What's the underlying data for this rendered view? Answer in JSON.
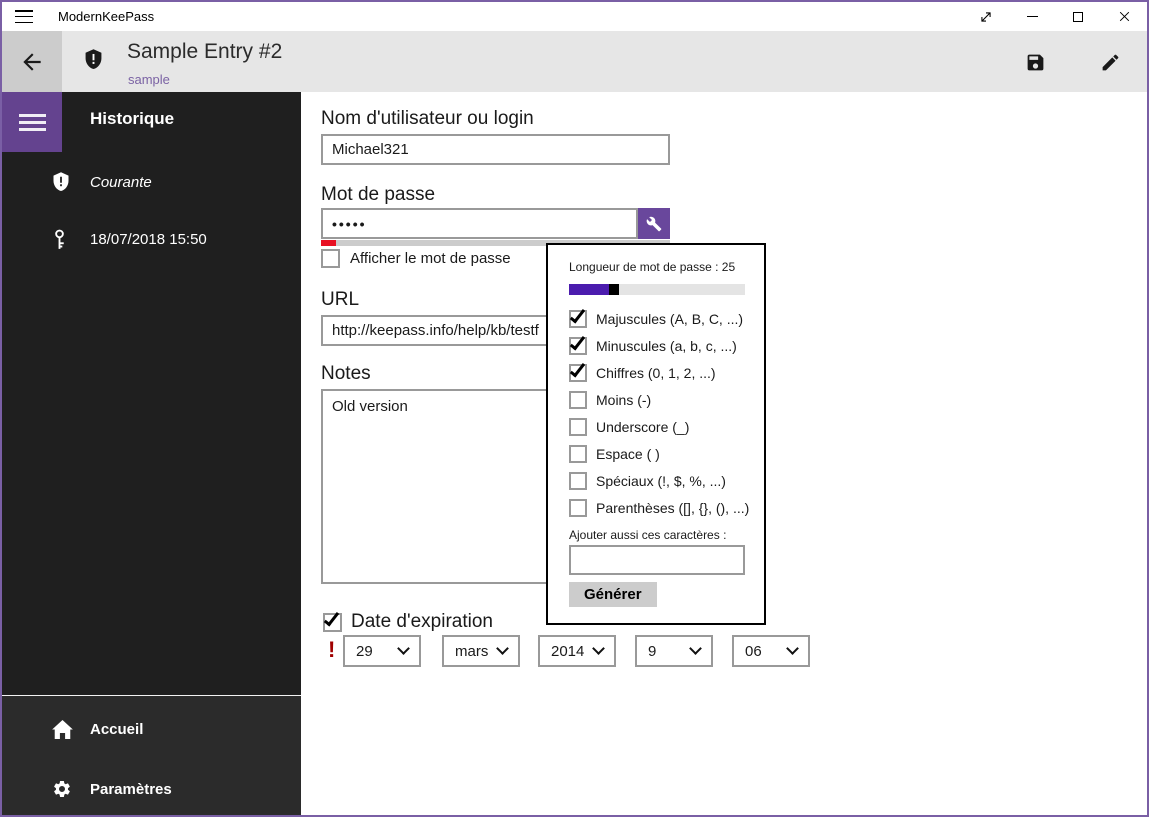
{
  "titlebar": {
    "app_title": "ModernKeePass"
  },
  "header": {
    "title": "Sample Entry #2",
    "subtitle": "sample"
  },
  "sidebar": {
    "heading": "Historique",
    "items": [
      {
        "icon": "shield-icon",
        "label": "Courante"
      },
      {
        "icon": "key-icon",
        "label": "18/07/2018 15:50"
      }
    ],
    "footer_items": [
      {
        "icon": "home-icon",
        "label": "Accueil"
      },
      {
        "icon": "gear-icon",
        "label": "Paramètres"
      }
    ]
  },
  "form": {
    "username_label": "Nom d'utilisateur ou login",
    "username_value": "Michael321",
    "password_label": "Mot de passe",
    "password_value": "•••••",
    "show_password_label": "Afficher le mot de passe",
    "show_password_checked": false,
    "url_label": "URL",
    "url_value": "http://keepass.info/help/kb/testf",
    "notes_label": "Notes",
    "notes_value": "Old version",
    "expiration_label": "Date d'expiration",
    "expiration_checked": true,
    "expiration_warning": "!",
    "date_parts": [
      "29",
      "mars",
      "2014",
      "9",
      "06"
    ]
  },
  "generator_popup": {
    "length_label": "Longueur de mot de passe : 25",
    "options": [
      {
        "label": "Majuscules (A, B, C, ...)",
        "checked": true
      },
      {
        "label": "Minuscules (a, b, c, ...)",
        "checked": true
      },
      {
        "label": "Chiffres (0, 1, 2, ...)",
        "checked": true
      },
      {
        "label": "Moins (-)",
        "checked": false
      },
      {
        "label": "Underscore (_)",
        "checked": false
      },
      {
        "label": "Espace ( )",
        "checked": false
      },
      {
        "label": "Spéciaux (!, $, %, ...)",
        "checked": false
      },
      {
        "label": "Parenthèses ([], {}, (), ...)",
        "checked": false
      }
    ],
    "additional_chars_label": "Ajouter aussi ces caractères :",
    "additional_chars_value": "",
    "generate_button": "Générer"
  },
  "icons": [
    "menu-icon",
    "back-icon",
    "shield-icon",
    "save-icon",
    "edit-icon",
    "expand-icon",
    "minimize-icon",
    "maximize-icon",
    "close-icon",
    "key-icon",
    "home-icon",
    "gear-icon",
    "wrench-icon",
    "checkmark-icon",
    "chevron-down-icon",
    "warning-icon"
  ],
  "colors": {
    "window_border": "#7a5fa5",
    "accent_purple": "#64438f",
    "wrench_button_purple": "#69479c",
    "subtitle_purple": "#7b63a4",
    "slider_fill_purple": "#4b1cae",
    "strength_bar_red": "#e81123",
    "warning_red": "#a00000",
    "sidebar_dark": "#1f1f1f",
    "sidebar_footer_dark": "#2b2b2b",
    "header_gray": "#e6e6e6"
  }
}
